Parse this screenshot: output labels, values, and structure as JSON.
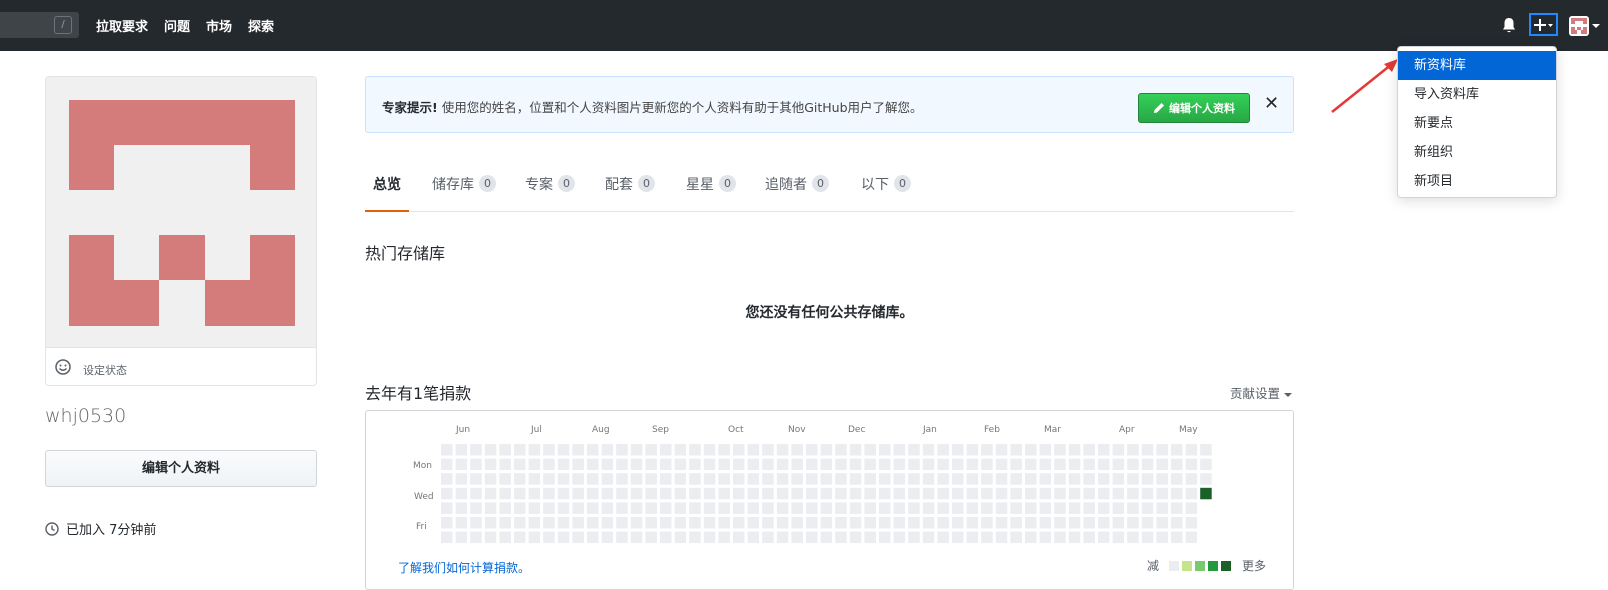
{
  "header": {
    "search_shortcut": "/",
    "nav": [
      "拉取要求",
      "问题",
      "市场",
      "探索"
    ]
  },
  "dropdown": {
    "items": [
      "新资料库",
      "导入资料库",
      "新要点",
      "新组织",
      "新项目"
    ],
    "active_index": 0
  },
  "profile": {
    "set_status": "设定状态",
    "username": "whj0530",
    "edit_button": "编辑个人资料",
    "joined": "已加入 7分钟前"
  },
  "tip": {
    "bold": "专家提示!",
    "text": "使用您的姓名，位置和个人资料图片更新您的个人资料有助于其他GitHub用户了解您。",
    "button": "编辑个人资料",
    "close": "✕"
  },
  "tabs": [
    {
      "label": "总览",
      "count": null
    },
    {
      "label": "储存库",
      "count": "0"
    },
    {
      "label": "专案",
      "count": "0"
    },
    {
      "label": "配套",
      "count": "0"
    },
    {
      "label": "星星",
      "count": "0"
    },
    {
      "label": "追随者",
      "count": "0"
    },
    {
      "label": "以下",
      "count": "0"
    }
  ],
  "popular": {
    "title": "热门存储库",
    "empty": "您还没有任何公共存储库。"
  },
  "contributions": {
    "title": "去年有1笔捐款",
    "settings": "贡献设置",
    "months": [
      "Jun",
      "Jul",
      "Aug",
      "Sep",
      "Oct",
      "Nov",
      "Dec",
      "Jan",
      "Feb",
      "Mar",
      "Apr",
      "May"
    ],
    "days": [
      "Mon",
      "Wed",
      "Fri"
    ],
    "learn": "了解我们如何计算捐款。",
    "less": "减",
    "more": "更多"
  },
  "colors": {
    "header": "#24292e",
    "accent_blue": "#0366d6",
    "green": "#28a745",
    "avatar_pink": "#d47b7b",
    "tab_underline": "#e36209",
    "levels": [
      "#ebedf0",
      "#c6e48b",
      "#7bc96f",
      "#239a3b",
      "#196127"
    ]
  }
}
